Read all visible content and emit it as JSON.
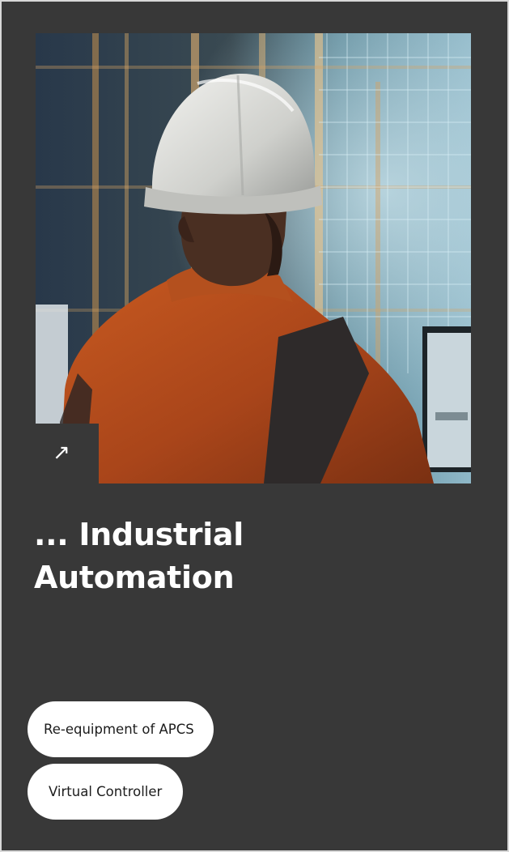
{
  "card": {
    "link_icon": "arrow-up-right-icon",
    "link_glyph": "↗",
    "title_line1": "... Industrial",
    "title_line2": "Automation"
  },
  "tags": [
    {
      "label": "Re-equipment of APCS"
    },
    {
      "label": "Virtual Controller"
    }
  ],
  "colors": {
    "card_background": "#383838",
    "tag_background": "#ffffff",
    "tag_text": "#1c1c1c",
    "title_text": "#ffffff",
    "accent_orange": "#c0521c"
  }
}
